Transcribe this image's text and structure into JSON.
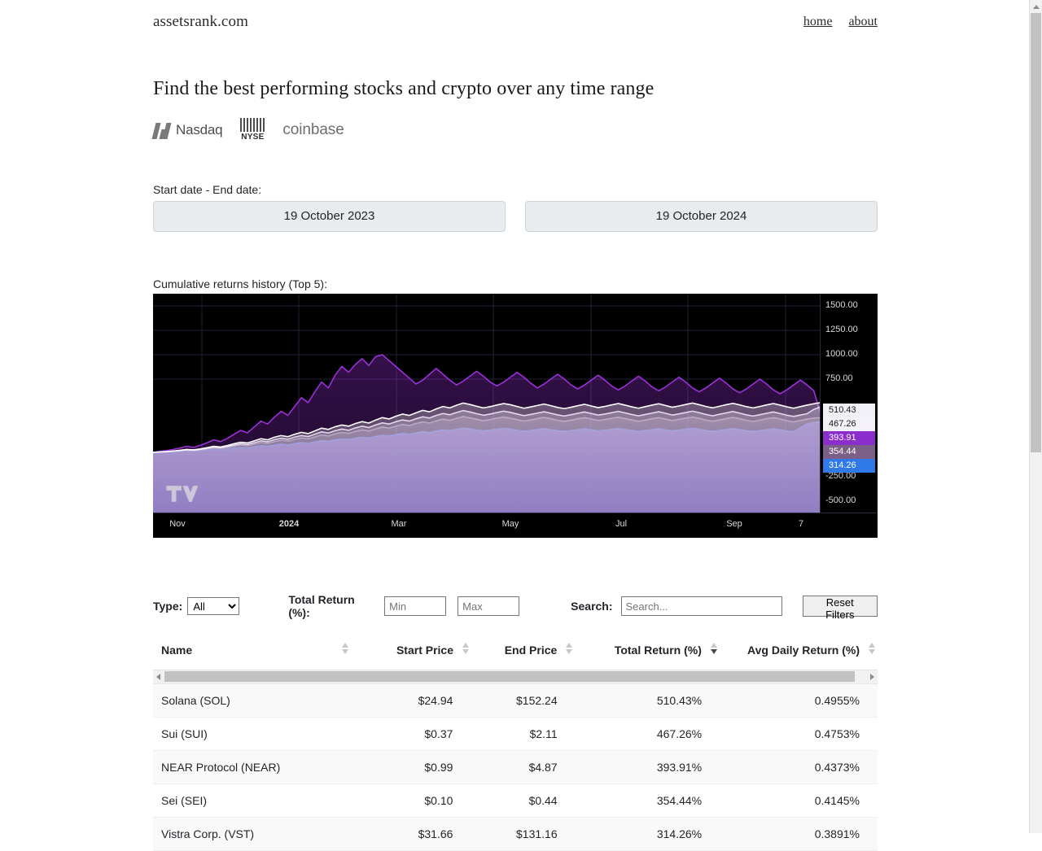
{
  "header": {
    "brand": "assetsrank.com",
    "nav": [
      {
        "label": "home"
      },
      {
        "label": "about"
      }
    ]
  },
  "hero": {
    "title": "Find the best performing stocks and crypto over any time range",
    "logos": [
      {
        "name": "nasdaq",
        "label": "Nasdaq"
      },
      {
        "name": "nyse",
        "label": "NYSE"
      },
      {
        "name": "coinbase",
        "label": "coinbase"
      }
    ]
  },
  "date_filter": {
    "label": "Start date - End date:",
    "start_date": "19 October 2023",
    "end_date": "19 October 2024"
  },
  "chart_section": {
    "label": "Cumulative returns history (Top 5):",
    "watermark": "tradingview-logo"
  },
  "chart_data": {
    "type": "area",
    "title": "Cumulative returns history (Top 5)",
    "xlabel": "",
    "ylabel": "",
    "ylim": [
      -625,
      1625
    ],
    "grid": true,
    "legend": "price-scale-badges",
    "y_ticks": [
      "1500.00",
      "1250.00",
      "1000.00",
      "750.00",
      "-250.00",
      "-500.00"
    ],
    "y_tick_values": [
      1500,
      1250,
      1000,
      750,
      -250,
      -500
    ],
    "x_ticks": [
      "Nov",
      "2024",
      "Mar",
      "May",
      "Jul",
      "Sep",
      "7"
    ],
    "x_tick_bold": "2024",
    "last_value_badges": [
      {
        "value": "510.43",
        "bg": "#f2f0f7",
        "fg": "#1a1a1a"
      },
      {
        "value": "467.26",
        "bg": "#f4f1f8",
        "fg": "#1a1a1a"
      },
      {
        "value": "393.91",
        "bg": "#8b2ecc",
        "fg": "#ffffff"
      },
      {
        "value": "354.44",
        "bg": "#7b5f86",
        "fg": "#ffffff"
      },
      {
        "value": "314.26",
        "bg": "#2f7ae8",
        "fg": "#ffffff"
      }
    ],
    "series": [
      {
        "name": "Solana (SOL)",
        "color": "#ffffff",
        "final": 510.43,
        "values": [
          0,
          5,
          8,
          14,
          22,
          30,
          26,
          35,
          48,
          62,
          55,
          70,
          88,
          104,
          96,
          118,
          140,
          128,
          155,
          172,
          160,
          185,
          205,
          192,
          220,
          248,
          235,
          262,
          280,
          268,
          295,
          315,
          300,
          330,
          356,
          342,
          370,
          392,
          378,
          405,
          430,
          415,
          445,
          470,
          455,
          482,
          505,
          490,
          472,
          455,
          468,
          485,
          500,
          488,
          470,
          452,
          465,
          480,
          495,
          478,
          460,
          448,
          462,
          478,
          492,
          475,
          458,
          470,
          486,
          500,
          484,
          466,
          452,
          468,
          484,
          498,
          480,
          462,
          475,
          490,
          505,
          488,
          470,
          456,
          472,
          488,
          502,
          486,
          468,
          455,
          470,
          486,
          500,
          484,
          466,
          452,
          468,
          484,
          498,
          510
        ]
      },
      {
        "name": "Sui (SUI)",
        "color": "#d9c8e8",
        "final": 467.26,
        "values": [
          0,
          4,
          7,
          12,
          18,
          25,
          21,
          29,
          40,
          52,
          46,
          58,
          74,
          88,
          80,
          99,
          118,
          108,
          130,
          145,
          134,
          156,
          172,
          162,
          186,
          210,
          198,
          222,
          238,
          226,
          250,
          268,
          254,
          280,
          302,
          290,
          314,
          332,
          320,
          344,
          364,
          352,
          378,
          398,
          385,
          408,
          428,
          414,
          396,
          380,
          392,
          408,
          422,
          410,
          392,
          376,
          388,
          402,
          416,
          400,
          384,
          372,
          386,
          400,
          414,
          398,
          382,
          392,
          406,
          420,
          404,
          388,
          374,
          388,
          402,
          416,
          400,
          382,
          394,
          408,
          422,
          406,
          388,
          374,
          390,
          404,
          418,
          402,
          384,
          372,
          386,
          400,
          414,
          398,
          380,
          368,
          382,
          396,
          440,
          467
        ]
      },
      {
        "name": "NEAR Protocol (NEAR)",
        "color": "#9b30d9",
        "final": 393.91,
        "values": [
          0,
          10,
          18,
          30,
          45,
          62,
          50,
          72,
          98,
          128,
          110,
          142,
          185,
          225,
          200,
          260,
          320,
          290,
          360,
          420,
          380,
          470,
          560,
          510,
          620,
          720,
          660,
          790,
          880,
          820,
          900,
          960,
          890,
          980,
          1000,
          940,
          880,
          820,
          760,
          700,
          740,
          800,
          860,
          800,
          740,
          690,
          730,
          780,
          830,
          780,
          720,
          680,
          720,
          770,
          820,
          770,
          710,
          660,
          700,
          750,
          800,
          750,
          690,
          650,
          690,
          740,
          790,
          740,
          680,
          640,
          680,
          730,
          780,
          730,
          670,
          630,
          670,
          720,
          770,
          720,
          660,
          620,
          660,
          710,
          760,
          710,
          650,
          610,
          650,
          700,
          750,
          700,
          640,
          600,
          640,
          690,
          740,
          690,
          630,
          394
        ]
      },
      {
        "name": "Sei (SEI)",
        "color": "#8a6f9e",
        "final": 354.44,
        "values": [
          0,
          3,
          6,
          10,
          15,
          21,
          18,
          25,
          34,
          44,
          38,
          50,
          62,
          74,
          68,
          84,
          100,
          92,
          110,
          124,
          114,
          132,
          148,
          138,
          158,
          178,
          168,
          190,
          204,
          194,
          214,
          230,
          218,
          240,
          260,
          248,
          268,
          286,
          274,
          296,
          312,
          300,
          322,
          340,
          328,
          348,
          366,
          354,
          338,
          324,
          336,
          350,
          362,
          350,
          334,
          320,
          332,
          346,
          358,
          344,
          328,
          318,
          330,
          344,
          356,
          342,
          326,
          336,
          348,
          360,
          346,
          332,
          318,
          330,
          344,
          356,
          340,
          326,
          338,
          350,
          362,
          348,
          330,
          318,
          332,
          346,
          358,
          344,
          328,
          316,
          330,
          344,
          356,
          342,
          324,
          312,
          326,
          340,
          352,
          354
        ]
      },
      {
        "name": "Vistra Corp. (VST)",
        "color": "#2f7ae8",
        "final": 314.26,
        "values": [
          0,
          2,
          4,
          7,
          10,
          14,
          12,
          17,
          23,
          30,
          26,
          34,
          42,
          50,
          46,
          57,
          68,
          62,
          74,
          84,
          77,
          89,
          100,
          93,
          107,
          120,
          113,
          128,
          137,
          131,
          144,
          155,
          147,
          162,
          175,
          167,
          181,
          193,
          185,
          200,
          211,
          203,
          218,
          230,
          222,
          236,
          248,
          240,
          229,
          219,
          227,
          237,
          245,
          237,
          226,
          216,
          224,
          234,
          242,
          232,
          222,
          215,
          223,
          232,
          241,
          231,
          220,
          227,
          235,
          244,
          234,
          224,
          215,
          223,
          232,
          241,
          230,
          220,
          228,
          237,
          246,
          236,
          223,
          215,
          224,
          234,
          243,
          233,
          222,
          214,
          223,
          232,
          241,
          231,
          219,
          212,
          250,
          290,
          305,
          314
        ]
      }
    ]
  },
  "filters": {
    "type_label": "Type:",
    "type_value": "All",
    "type_options": [
      "All"
    ],
    "total_return_label": "Total Return (%):",
    "min_placeholder": "Min",
    "min_value": "",
    "max_placeholder": "Max",
    "max_value": "",
    "search_label": "Search:",
    "search_placeholder": "Search...",
    "search_value": "",
    "reset_label": "Reset Filters"
  },
  "table": {
    "columns": [
      {
        "label": "Name",
        "sort": "none"
      },
      {
        "label": "Start Price",
        "sort": "none"
      },
      {
        "label": "End Price",
        "sort": "none"
      },
      {
        "label": "Total Return (%)",
        "sort": "desc"
      },
      {
        "label": "Avg Daily Return (%)",
        "sort": "none"
      }
    ],
    "rows": [
      {
        "name": "Solana (SOL)",
        "start": "$24.94",
        "end": "$152.24",
        "total": "510.43%",
        "avg": "0.4955%"
      },
      {
        "name": "Sui (SUI)",
        "start": "$0.37",
        "end": "$2.11",
        "total": "467.26%",
        "avg": "0.4753%"
      },
      {
        "name": "NEAR Protocol (NEAR)",
        "start": "$0.99",
        "end": "$4.87",
        "total": "393.91%",
        "avg": "0.4373%"
      },
      {
        "name": "Sei (SEI)",
        "start": "$0.10",
        "end": "$0.44",
        "total": "354.44%",
        "avg": "0.4145%"
      },
      {
        "name": "Vistra Corp. (VST)",
        "start": "$31.66",
        "end": "$131.16",
        "total": "314.26%",
        "avg": "0.3891%"
      }
    ]
  }
}
